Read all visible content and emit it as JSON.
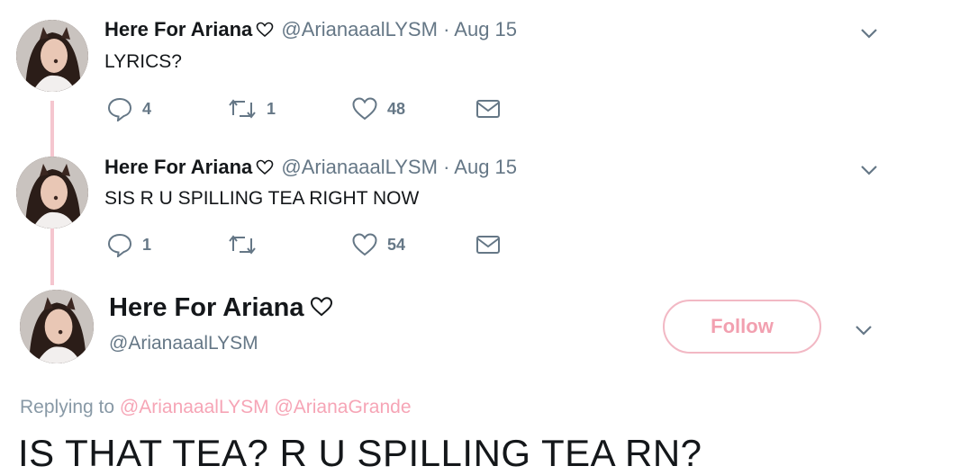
{
  "replies": [
    {
      "name": "Here For Ariana",
      "handle": "@ArianaaalLYSM",
      "separator": "·",
      "date": "Aug 15",
      "text": "LYRICS?",
      "reply_count": "4",
      "retweet_count": "1",
      "like_count": "48"
    },
    {
      "name": "Here For Ariana",
      "handle": "@ArianaaalLYSM",
      "separator": "·",
      "date": "Aug 15",
      "text": "SIS R U SPILLING TEA RIGHT NOW",
      "reply_count": "1",
      "retweet_count": "",
      "like_count": "54"
    }
  ],
  "main": {
    "name": "Here For Ariana",
    "handle": "@ArianaaalLYSM",
    "follow_label": "Follow",
    "replying_label": "Replying to",
    "replying_mentions": [
      "@ArianaaalLYSM",
      "@ArianaGrande"
    ],
    "text": "IS THAT TEA? R U SPILLING TEA RN?"
  },
  "colors": {
    "accent_pink": "#f2a0b0",
    "thread_line": "#f5c6cf",
    "secondary_text": "#657786"
  }
}
